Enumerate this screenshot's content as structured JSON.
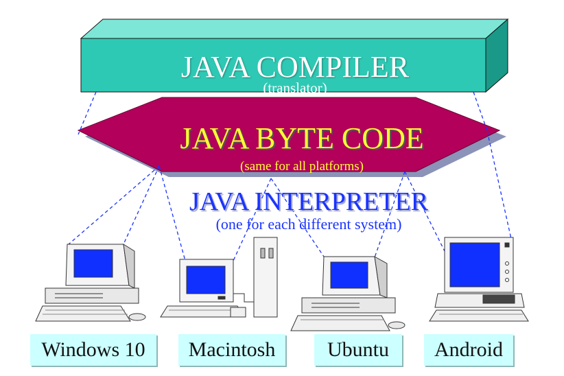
{
  "compiler": {
    "title": "JAVA COMPILER",
    "subtitle": "(translator)",
    "color": "#2ec9b4"
  },
  "bytecode": {
    "title": "JAVA BYTE CODE",
    "subtitle": "(same for all platforms)",
    "color": "#b3005a",
    "text_color": "#ffff33"
  },
  "interpreter": {
    "title": "JAVA INTERPRETER",
    "subtitle": "(one for each different system)",
    "color": "#1a33ff"
  },
  "platforms": [
    {
      "label": "Windows 10"
    },
    {
      "label": "Macintosh"
    },
    {
      "label": "Ubuntu"
    },
    {
      "label": "Android"
    }
  ],
  "colors": {
    "label_bg": "#ccffff",
    "screen": "#1030ff",
    "connector": "#1a33ff"
  }
}
